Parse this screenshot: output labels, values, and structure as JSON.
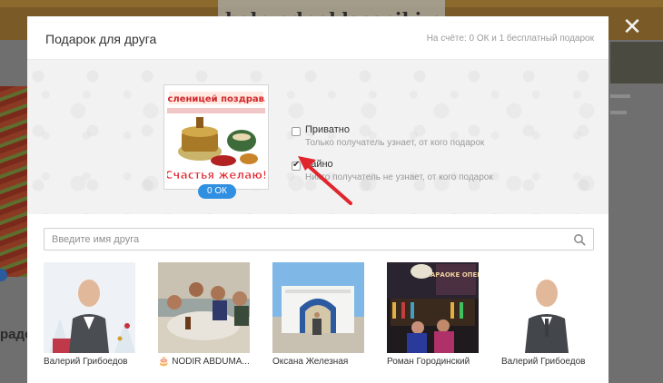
{
  "watermark": "help-odnoklassniki.ru",
  "modal": {
    "title": "Подарок для друга",
    "balance": "На счёте: 0 ОК и 1 бесплатный подарок"
  },
  "gift": {
    "card_text_top": "С Масленицей поздравляю!",
    "card_text_bottom": "Счастья желаю!",
    "price": "0 ОК"
  },
  "options": [
    {
      "label": "Приватно",
      "hint": "Только получатель узнает, от кого подарок",
      "checked": false
    },
    {
      "label": "Тайно",
      "hint": "Никто получатель не узнает, от кого подарок",
      "checked": true
    }
  ],
  "search": {
    "placeholder": "Введите имя друга",
    "value": ""
  },
  "friends": [
    {
      "name": "Валерий Грибоедов"
    },
    {
      "name": "🎂 NODIR ABDUMA..."
    },
    {
      "name": "Оксана Железная"
    },
    {
      "name": "Роман Городинский"
    },
    {
      "name": "Валерий Грибоедов"
    }
  ],
  "photo_texts": {
    "karaoke": "КАРАОКЕ ОПЕРА"
  },
  "background": {
    "left_text": "радо"
  },
  "colors": {
    "accent": "#2f8fe0",
    "arrow": "#e0262c",
    "header_bar": "#7a5a26"
  }
}
